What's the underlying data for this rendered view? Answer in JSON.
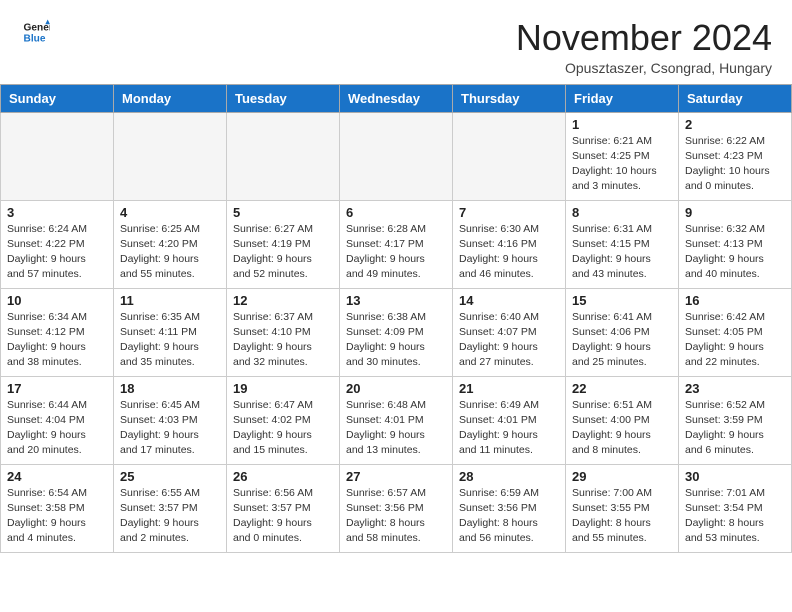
{
  "header": {
    "logo_line1": "General",
    "logo_line2": "Blue",
    "month": "November 2024",
    "location": "Opusztaszer, Csongrad, Hungary"
  },
  "days_of_week": [
    "Sunday",
    "Monday",
    "Tuesday",
    "Wednesday",
    "Thursday",
    "Friday",
    "Saturday"
  ],
  "weeks": [
    [
      {
        "day": "",
        "detail": ""
      },
      {
        "day": "",
        "detail": ""
      },
      {
        "day": "",
        "detail": ""
      },
      {
        "day": "",
        "detail": ""
      },
      {
        "day": "",
        "detail": ""
      },
      {
        "day": "1",
        "detail": "Sunrise: 6:21 AM\nSunset: 4:25 PM\nDaylight: 10 hours\nand 3 minutes."
      },
      {
        "day": "2",
        "detail": "Sunrise: 6:22 AM\nSunset: 4:23 PM\nDaylight: 10 hours\nand 0 minutes."
      }
    ],
    [
      {
        "day": "3",
        "detail": "Sunrise: 6:24 AM\nSunset: 4:22 PM\nDaylight: 9 hours\nand 57 minutes."
      },
      {
        "day": "4",
        "detail": "Sunrise: 6:25 AM\nSunset: 4:20 PM\nDaylight: 9 hours\nand 55 minutes."
      },
      {
        "day": "5",
        "detail": "Sunrise: 6:27 AM\nSunset: 4:19 PM\nDaylight: 9 hours\nand 52 minutes."
      },
      {
        "day": "6",
        "detail": "Sunrise: 6:28 AM\nSunset: 4:17 PM\nDaylight: 9 hours\nand 49 minutes."
      },
      {
        "day": "7",
        "detail": "Sunrise: 6:30 AM\nSunset: 4:16 PM\nDaylight: 9 hours\nand 46 minutes."
      },
      {
        "day": "8",
        "detail": "Sunrise: 6:31 AM\nSunset: 4:15 PM\nDaylight: 9 hours\nand 43 minutes."
      },
      {
        "day": "9",
        "detail": "Sunrise: 6:32 AM\nSunset: 4:13 PM\nDaylight: 9 hours\nand 40 minutes."
      }
    ],
    [
      {
        "day": "10",
        "detail": "Sunrise: 6:34 AM\nSunset: 4:12 PM\nDaylight: 9 hours\nand 38 minutes."
      },
      {
        "day": "11",
        "detail": "Sunrise: 6:35 AM\nSunset: 4:11 PM\nDaylight: 9 hours\nand 35 minutes."
      },
      {
        "day": "12",
        "detail": "Sunrise: 6:37 AM\nSunset: 4:10 PM\nDaylight: 9 hours\nand 32 minutes."
      },
      {
        "day": "13",
        "detail": "Sunrise: 6:38 AM\nSunset: 4:09 PM\nDaylight: 9 hours\nand 30 minutes."
      },
      {
        "day": "14",
        "detail": "Sunrise: 6:40 AM\nSunset: 4:07 PM\nDaylight: 9 hours\nand 27 minutes."
      },
      {
        "day": "15",
        "detail": "Sunrise: 6:41 AM\nSunset: 4:06 PM\nDaylight: 9 hours\nand 25 minutes."
      },
      {
        "day": "16",
        "detail": "Sunrise: 6:42 AM\nSunset: 4:05 PM\nDaylight: 9 hours\nand 22 minutes."
      }
    ],
    [
      {
        "day": "17",
        "detail": "Sunrise: 6:44 AM\nSunset: 4:04 PM\nDaylight: 9 hours\nand 20 minutes."
      },
      {
        "day": "18",
        "detail": "Sunrise: 6:45 AM\nSunset: 4:03 PM\nDaylight: 9 hours\nand 17 minutes."
      },
      {
        "day": "19",
        "detail": "Sunrise: 6:47 AM\nSunset: 4:02 PM\nDaylight: 9 hours\nand 15 minutes."
      },
      {
        "day": "20",
        "detail": "Sunrise: 6:48 AM\nSunset: 4:01 PM\nDaylight: 9 hours\nand 13 minutes."
      },
      {
        "day": "21",
        "detail": "Sunrise: 6:49 AM\nSunset: 4:01 PM\nDaylight: 9 hours\nand 11 minutes."
      },
      {
        "day": "22",
        "detail": "Sunrise: 6:51 AM\nSunset: 4:00 PM\nDaylight: 9 hours\nand 8 minutes."
      },
      {
        "day": "23",
        "detail": "Sunrise: 6:52 AM\nSunset: 3:59 PM\nDaylight: 9 hours\nand 6 minutes."
      }
    ],
    [
      {
        "day": "24",
        "detail": "Sunrise: 6:54 AM\nSunset: 3:58 PM\nDaylight: 9 hours\nand 4 minutes."
      },
      {
        "day": "25",
        "detail": "Sunrise: 6:55 AM\nSunset: 3:57 PM\nDaylight: 9 hours\nand 2 minutes."
      },
      {
        "day": "26",
        "detail": "Sunrise: 6:56 AM\nSunset: 3:57 PM\nDaylight: 9 hours\nand 0 minutes."
      },
      {
        "day": "27",
        "detail": "Sunrise: 6:57 AM\nSunset: 3:56 PM\nDaylight: 8 hours\nand 58 minutes."
      },
      {
        "day": "28",
        "detail": "Sunrise: 6:59 AM\nSunset: 3:56 PM\nDaylight: 8 hours\nand 56 minutes."
      },
      {
        "day": "29",
        "detail": "Sunrise: 7:00 AM\nSunset: 3:55 PM\nDaylight: 8 hours\nand 55 minutes."
      },
      {
        "day": "30",
        "detail": "Sunrise: 7:01 AM\nSunset: 3:54 PM\nDaylight: 8 hours\nand 53 minutes."
      }
    ]
  ]
}
